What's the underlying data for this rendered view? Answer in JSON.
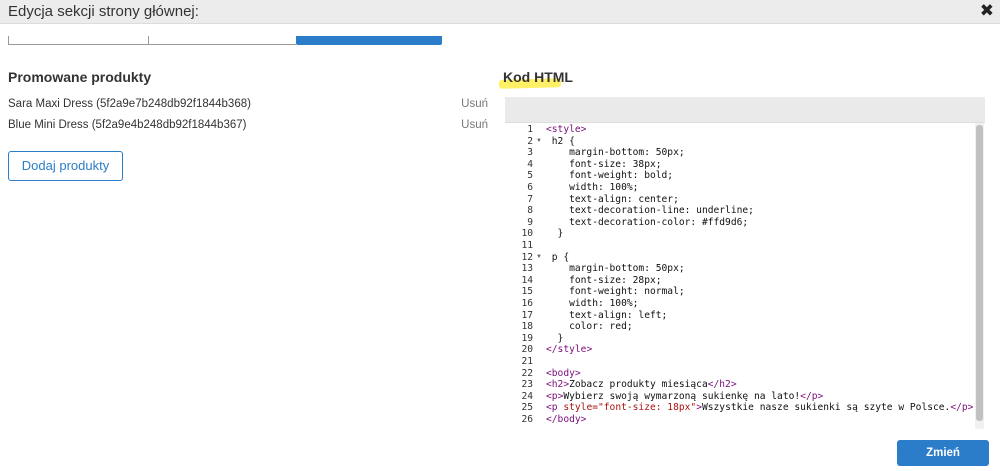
{
  "modal": {
    "title": "Edycja sekcji strony głównej:",
    "close_icon": "close-icon",
    "close_glyph": "✖",
    "submit_label": "Zmień"
  },
  "tabs": [
    {
      "label": "",
      "active": false
    },
    {
      "label": "",
      "active": false
    },
    {
      "label": "",
      "active": true
    }
  ],
  "promoted": {
    "title": "Promowane produkty",
    "items": [
      {
        "name": "Sara Maxi Dress (5f2a9e7b248db92f1844b368)",
        "remove_label": "Usuń"
      },
      {
        "name": "Blue Mini Dress (5f2a9e4b248db92f1844b367)",
        "remove_label": "Usuń"
      }
    ],
    "add_label": "Dodaj produkty"
  },
  "html_section": {
    "title": "Kod HTML",
    "highlight_color": "#ffee55"
  },
  "colors": {
    "accent": "#2b7dc9",
    "tag": "#7a0e7a",
    "attr": "#a11111"
  },
  "editor": {
    "lines": [
      {
        "n": "1",
        "fold": false,
        "text": "<style>"
      },
      {
        "n": "2",
        "fold": true,
        "text": " h2 {"
      },
      {
        "n": "3",
        "fold": false,
        "text": "    margin-bottom: 50px;"
      },
      {
        "n": "4",
        "fold": false,
        "text": "    font-size: 38px;"
      },
      {
        "n": "5",
        "fold": false,
        "text": "    font-weight: bold;"
      },
      {
        "n": "6",
        "fold": false,
        "text": "    width: 100%;"
      },
      {
        "n": "7",
        "fold": false,
        "text": "    text-align: center;"
      },
      {
        "n": "8",
        "fold": false,
        "text": "    text-decoration-line: underline;"
      },
      {
        "n": "9",
        "fold": false,
        "text": "    text-decoration-color: #ffd9d6;"
      },
      {
        "n": "10",
        "fold": false,
        "text": "  }"
      },
      {
        "n": "11",
        "fold": false,
        "text": ""
      },
      {
        "n": "12",
        "fold": true,
        "text": " p {"
      },
      {
        "n": "13",
        "fold": false,
        "text": "    margin-bottom: 50px;"
      },
      {
        "n": "14",
        "fold": false,
        "text": "    font-size: 28px;"
      },
      {
        "n": "15",
        "fold": false,
        "text": "    font-weight: normal;"
      },
      {
        "n": "16",
        "fold": false,
        "text": "    width: 100%;"
      },
      {
        "n": "17",
        "fold": false,
        "text": "    text-align: left;"
      },
      {
        "n": "18",
        "fold": false,
        "text": "    color: red;"
      },
      {
        "n": "19",
        "fold": false,
        "text": "  }"
      },
      {
        "n": "20",
        "fold": false,
        "text": "</style>"
      },
      {
        "n": "21",
        "fold": false,
        "text": ""
      },
      {
        "n": "22",
        "fold": false,
        "text": "<body>"
      },
      {
        "n": "23",
        "fold": false,
        "text": "<h2>Zobacz produkty miesiąca</h2>"
      },
      {
        "n": "24",
        "fold": false,
        "text": "<p>Wybierz swoją wymarzoną sukienkę na lato!</p>"
      },
      {
        "n": "25",
        "fold": false,
        "text": "<p style=\"font-size: 18px\">Wszystkie nasze sukienki są szyte w Polsce.</p>"
      },
      {
        "n": "26",
        "fold": false,
        "text": "</body>"
      }
    ]
  }
}
